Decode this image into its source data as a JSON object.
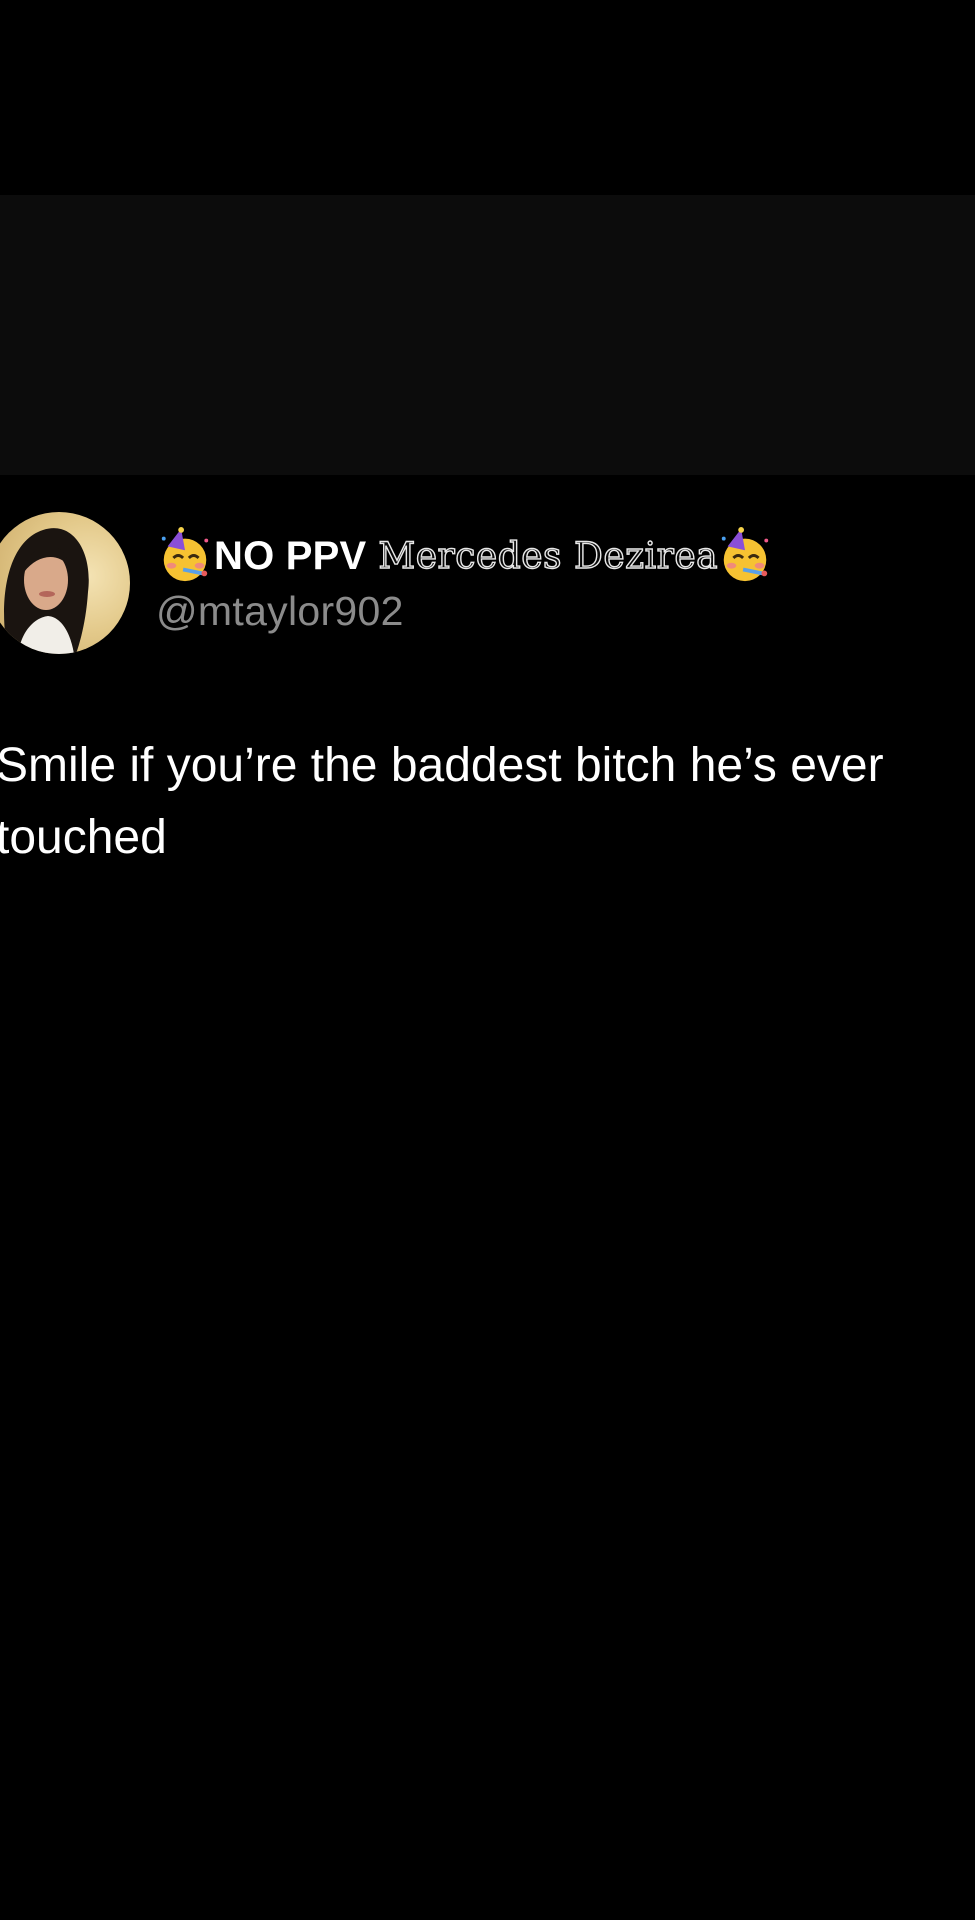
{
  "tweet": {
    "display_name_prefix": "NO PPV",
    "display_name_styled": "Mercedes Dezirea",
    "handle": "@mtaylor902",
    "text": "Smile if you’re the baddest bitch he’s ever\ntouched",
    "icons": {
      "name_emoji": "partying-face-icon"
    }
  },
  "colors": {
    "background": "#000000",
    "band": "#0c0c0c",
    "text": "#ffffff",
    "handle": "#8b8b8b"
  }
}
